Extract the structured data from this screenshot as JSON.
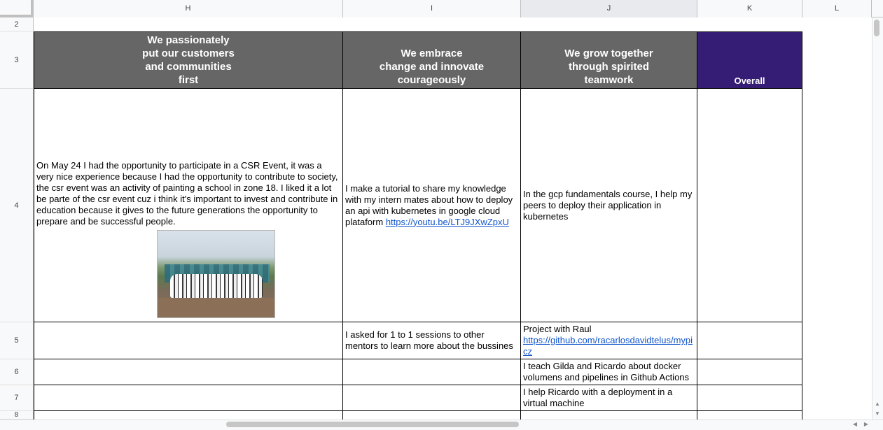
{
  "columns": {
    "H": "H",
    "I": "I",
    "J": "J",
    "K": "K",
    "L": "L"
  },
  "rows": {
    "r2": "2",
    "r3": "3",
    "r4": "4",
    "r5": "5",
    "r6": "6",
    "r7": "7",
    "r8": "8"
  },
  "headers": {
    "h": "We passionately\nput our customers\nand communities\nfirst",
    "i": "We embrace\nchange and innovate\ncourageously",
    "j": "We grow together\nthrough spirited\nteamwork",
    "k": "Overall"
  },
  "cells": {
    "h4_text": "On May 24 I had the opportunity to participate in a CSR Event, it was a very nice experience because I had the opportunity to contribute to society, the csr event was an activity of painting a school in zone 18. I liked it a lot be parte of the csr event cuz i think it's important to invest and contribute in education because it gives to the future generations the opportunity to prepare and be successful people.",
    "i4_text": "I make a tutorial to share my knowledge with my intern mates about how to deploy an api with kubernetes in google cloud plataform ",
    "i4_link": "https://youtu.be/LTJ9JXwZpxU",
    "j4_text": "In the gcp fundamentals course, I help my peers to deploy their application in kubernetes",
    "i5_text": "I asked for 1 to 1 sessions to other mentors to learn more about the bussines",
    "j5_text": "Project with Raul",
    "j5_link": "https://github.com/racarlosdavidtelus/mypicz",
    "j6_text": "I teach Gilda and Ricardo about docker volumens and pipelines in Github Actions",
    "j7_text": "I help Ricardo with a deployment in a virtual machine"
  },
  "icons": {
    "scroll_up": "▲",
    "scroll_down": "▼",
    "scroll_left": "◀",
    "scroll_right": "▶"
  },
  "colors": {
    "header_gray": "#666666",
    "header_purple": "#351c75",
    "link": "#1155cc"
  }
}
